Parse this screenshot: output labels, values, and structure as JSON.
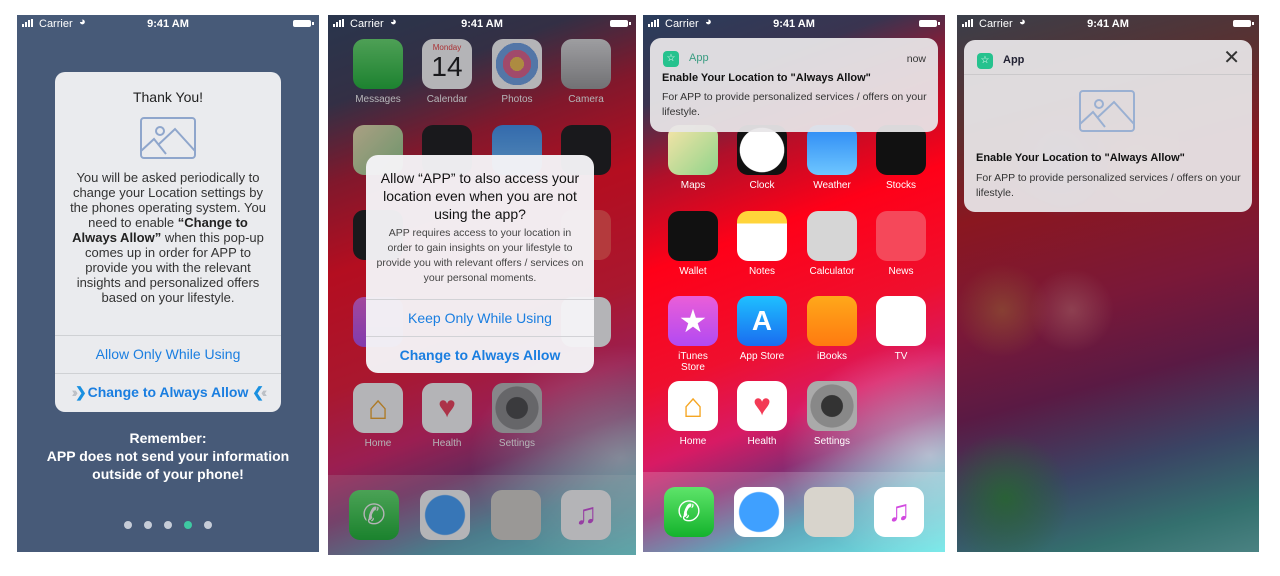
{
  "status_bar": {
    "carrier": "Carrier",
    "time": "9:41 AM",
    "wifi_icon": "wifi-icon",
    "battery_icon": "battery-icon",
    "signal_icon": "signal-icon"
  },
  "panel1": {
    "title": "Thank You!",
    "image_icon": "image-placeholder-icon",
    "body_before": "You will be asked periodically to change your Location settings by the phones operating system. You need to enable",
    "body_bold": "“Change to Always Allow”",
    "body_after": "when this pop-up comes up in order for APP to provide you with the relevant insights and personalized offers based on your lifestyle.",
    "button_allow_only": "Allow Only While Using",
    "button_always": "Change to Always Allow",
    "remember_title": "Remember:",
    "remember_line1": "APP does not send your information",
    "remember_line2": "outside of your phone!",
    "pagination": {
      "total": 5,
      "active_index": 3
    },
    "colors": {
      "background": "#475a78",
      "accent": "#1a7ee0",
      "dot_active": "#3ec9a2"
    }
  },
  "panel2": {
    "alert_title": "Allow “APP” to also access your location even when you are not using the app?",
    "alert_message": "APP requires access to your location in order to gain insights on your lifestyle to provide you with relevant offers / services on your personal moments.",
    "button_keep": "Keep Only While Using",
    "button_change": "Change to Always Allow"
  },
  "home_apps": {
    "row1": [
      "Messages",
      "Calendar",
      "Photos",
      "Camera"
    ],
    "row2": [
      "Maps",
      "Clock",
      "Weather",
      "Stocks"
    ],
    "row3": [
      "Wallet",
      "Notes",
      "Calculator",
      "News"
    ],
    "row4": [
      "iTunes Store",
      "App Store",
      "iBooks",
      "TV"
    ],
    "row5": [
      "Home",
      "Health",
      "Settings"
    ],
    "dock": [
      "Phone",
      "Safari",
      "Contacts",
      "Music"
    ],
    "calendar_day": "Monday",
    "calendar_date": "14"
  },
  "panel3": {
    "app_name": "App",
    "time": "now",
    "title": "Enable Your Location to \"Always Allow\"",
    "body": "For APP to provide personalized services / offers on your lifestyle."
  },
  "panel4": {
    "app_name": "App",
    "close_icon": "close-icon",
    "title": "Enable Your Location to \"Always Allow\"",
    "body": "For APP to provide personalized services / offers on your lifestyle."
  }
}
